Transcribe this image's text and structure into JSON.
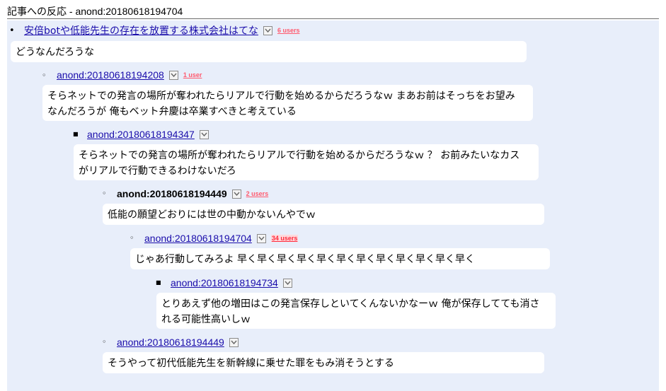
{
  "header": {
    "title": "記事への反応",
    "separator": " - ",
    "link": "anond:20180618194704"
  },
  "entries": [
    {
      "id_label": "安倍botや低能先生の存在を放置する株式会社はてな",
      "users": "6 users",
      "comment_lines": [
        "どうなんだろうな"
      ]
    },
    {
      "id_label": "anond:20180618194208",
      "users": "1 user",
      "comment_lines": [
        "そらネットでの発言の場所が奪われたらリアルで行動を始めるからだろうなｗ まあお前はそっちをお望み",
        "なんだろうが 俺もベット弁慶は卒業すべきと考えている"
      ]
    },
    {
      "id_label": "anond:20180618194347",
      "users": "",
      "comment_lines": [
        "そらネットでの発言の場所が奪われたらリアルで行動を始めるからだろうなｗ ？ お前みたいなカス",
        "がリアルで行動できるわけないだろ"
      ]
    },
    {
      "id_label": "anond:20180618194449",
      "users": "2 users",
      "comment_lines": [
        "低能の願望どおりには世の中動かないんやでｗ"
      ]
    },
    {
      "id_label": "anond:20180618194704",
      "users": "34 users",
      "comment_lines": [
        "じゃあ行動してみろよ 早く早く早く早く早く早く早く早く早く早く早く早く"
      ]
    },
    {
      "id_label": "anond:20180618194734",
      "users": "",
      "comment_lines": [
        "とりあえず他の増田はこの発言保存しといてくんないかなーｗ 俺が保存してても消さ",
        "れる可能性高いしｗ"
      ]
    },
    {
      "id_label": "anond:20180618194449",
      "users": "",
      "comment_lines": [
        "そうやって初代低能先生を新幹線に乗せた罪をもみ消そうとする"
      ]
    }
  ],
  "icons": {
    "menu": "chevron-down-icon",
    "bullet_level1": "disc-bullet-icon",
    "bullet_level2": "circle-bullet-icon",
    "bullet_level3": "square-bullet-icon"
  },
  "colors": {
    "link": "#1a0dab",
    "users": "#ff5a6e",
    "panel_bg": "#e8eefa"
  }
}
